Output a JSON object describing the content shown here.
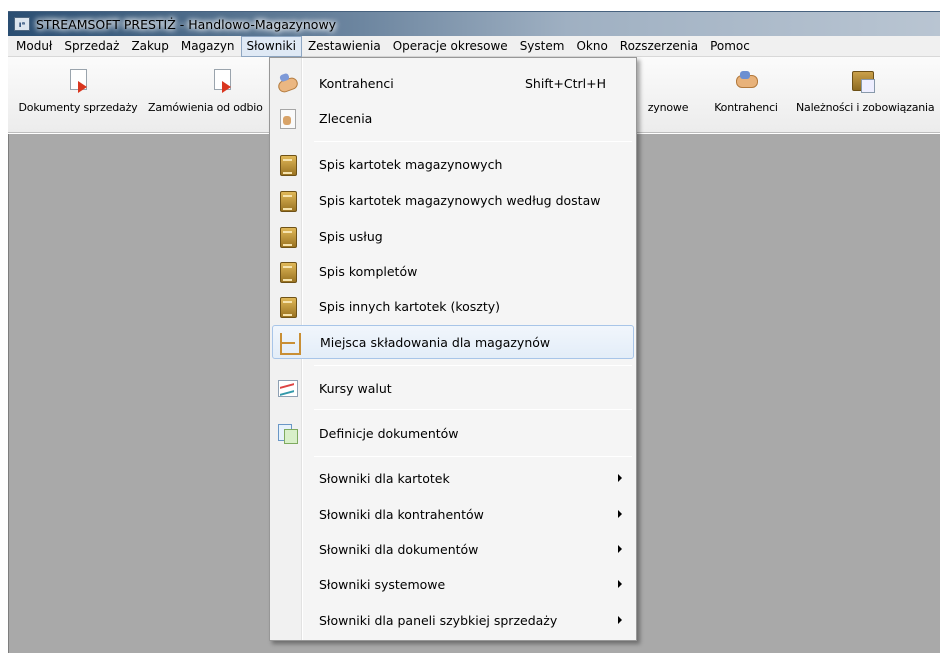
{
  "window": {
    "app_icon_text": "ıᵃ",
    "title": "STREAMSOFT PRESTIŻ - Handlowo-Magazynowy"
  },
  "menubar": [
    {
      "label": "Moduł"
    },
    {
      "label": "Sprzedaż"
    },
    {
      "label": "Zakup"
    },
    {
      "label": "Magazyn"
    },
    {
      "label": "Słowniki",
      "active": true
    },
    {
      "label": "Zestawienia"
    },
    {
      "label": "Operacje okresowe"
    },
    {
      "label": "System"
    },
    {
      "label": "Okno"
    },
    {
      "label": "Rozszerzenia"
    },
    {
      "label": "Pomoc"
    }
  ],
  "toolbar": [
    {
      "label": "Dokumenty sprzedaży",
      "icon": "document-arrow-icon"
    },
    {
      "label": "Zamówienia od odbio",
      "icon": "order-document-icon"
    },
    {
      "label": "zynowe",
      "icon": "hidden"
    },
    {
      "label": "Kontrahenci",
      "icon": "handshake-icon"
    },
    {
      "label": "Należności i zobowiązania",
      "icon": "cabinet-icon"
    }
  ],
  "dropdown": {
    "items": [
      {
        "label": "Kontrahenci",
        "shortcut": "Shift+Ctrl+H",
        "icon": "handshake-icon"
      },
      {
        "label": "Zlecenia",
        "icon": "order-icon"
      },
      {
        "label": "Spis kartotek magazynowych",
        "icon": "cabinet-icon"
      },
      {
        "label": "Spis kartotek magazynowych według dostaw",
        "icon": "cabinet-icon"
      },
      {
        "label": "Spis usług",
        "icon": "cabinet-icon"
      },
      {
        "label": "Spis kompletów",
        "icon": "cabinet-icon"
      },
      {
        "label": "Spis innych kartotek (koszty)",
        "icon": "cabinet-icon"
      },
      {
        "label": "Miejsca składowania dla magazynów",
        "icon": "shelf-icon",
        "highlighted": true
      },
      {
        "label": "Kursy walut",
        "icon": "chart-icon"
      },
      {
        "label": "Definicje dokumentów",
        "icon": "documents-icon"
      },
      {
        "label": "Słowniki dla kartotek",
        "submenu": true
      },
      {
        "label": "Słowniki dla kontrahentów",
        "submenu": true
      },
      {
        "label": "Słowniki dla dokumentów",
        "submenu": true
      },
      {
        "label": "Słowniki systemowe",
        "submenu": true
      },
      {
        "label": "Słowniki dla paneli szybkiej sprzedaży",
        "submenu": true
      }
    ]
  }
}
